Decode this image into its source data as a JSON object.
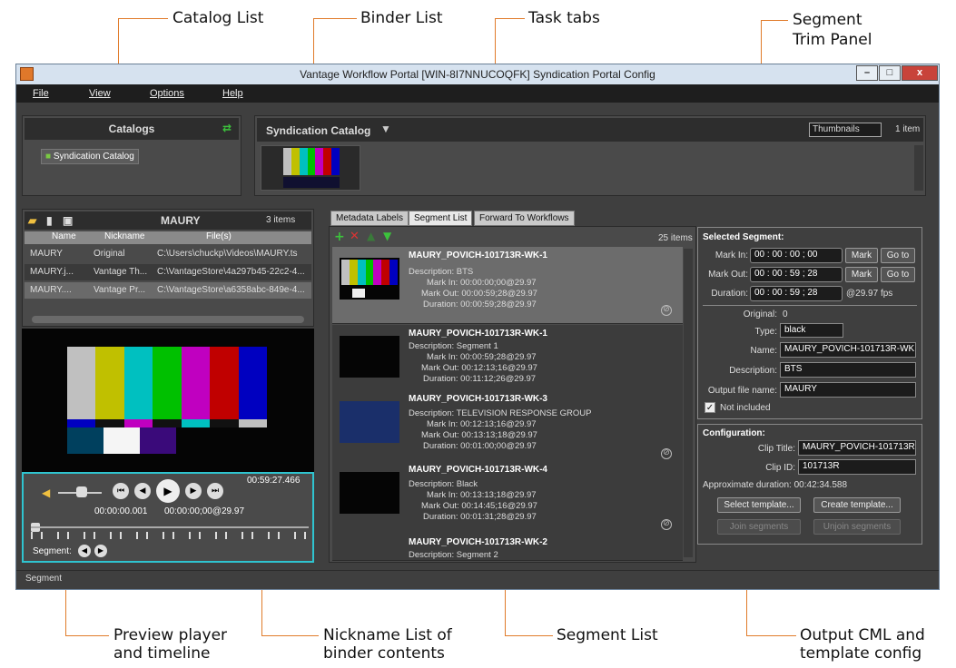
{
  "callouts": {
    "catalog": "Catalog List",
    "binder": "Binder List",
    "tasks": "Task tabs",
    "trim1": "Segment",
    "trim2": "Trim Panel",
    "preview1": "Preview player",
    "preview2": "and timeline",
    "nick1": "Nickname List of",
    "nick2": "binder contents",
    "seglist": "Segment List",
    "out1": "Output CML and",
    "out2": "template config"
  },
  "window": {
    "title": "Vantage Workflow Portal [WIN-8I7NNUCOQFK]  Syndication Portal Config",
    "min": "–",
    "max": "□",
    "close": "x"
  },
  "menu": [
    "File",
    "View",
    "Options",
    "Help"
  ],
  "catalogs": {
    "title": "Catalogs",
    "item": "Syndication Catalog"
  },
  "catalog_view": {
    "title": "Syndication Catalog",
    "view_mode": "Thumbnails",
    "count": "1 item"
  },
  "binder": {
    "title": "MAURY",
    "count": "3 items",
    "cols": [
      "Name",
      "Nickname",
      "File(s)"
    ],
    "rows": [
      [
        "MAURY",
        "Original",
        "C:\\Users\\chuckp\\Videos\\MAURY.ts"
      ],
      [
        "MAURY.j...",
        "Vantage Th...",
        "C:\\VantageStore\\4a297b45-22c2-4..."
      ],
      [
        "MAURY....",
        "Vantage Pr...",
        "C:\\VantageStore\\a6358abc-849e-4..."
      ]
    ]
  },
  "player": {
    "total": "00:59:27.466",
    "pos": "00:00:00.001",
    "tc": "00:00:00;00@29.97",
    "seg_label": "Segment:"
  },
  "tabs": [
    "Metadata Labels",
    "Segment List",
    "Forward To Workflows"
  ],
  "seglist": {
    "count": "25 items",
    "items": [
      {
        "name": "MAURY_POVICH-101713R-WK-1",
        "desc": "Description: BTS",
        "in": "Mark In: 00:00:00;00@29.97",
        "out": "Mark Out: 00:00:59;28@29.97",
        "dur": "Duration: 00:00:59;28@29.97"
      },
      {
        "name": "MAURY_POVICH-101713R-WK-1",
        "desc": "Description: Segment 1",
        "in": "Mark In: 00:00:59;28@29.97",
        "out": "Mark Out: 00:12:13;16@29.97",
        "dur": "Duration: 00:11:12;26@29.97"
      },
      {
        "name": "MAURY_POVICH-101713R-WK-3",
        "desc": "Description: TELEVISION RESPONSE GROUP",
        "in": "Mark In: 00:12:13;16@29.97",
        "out": "Mark Out: 00:13:13;18@29.97",
        "dur": "Duration: 00:01:00;00@29.97"
      },
      {
        "name": "MAURY_POVICH-101713R-WK-4",
        "desc": "Description: Black",
        "in": "Mark In: 00:13:13;18@29.97",
        "out": "Mark Out: 00:14:45;16@29.97",
        "dur": "Duration: 00:01:31;28@29.97"
      },
      {
        "name": "MAURY_POVICH-101713R-WK-2",
        "desc": "Description: Segment 2",
        "in": "",
        "out": "",
        "dur": ""
      }
    ]
  },
  "trim": {
    "title": "Selected Segment:",
    "mark_in_l": "Mark In:",
    "mark_in": "00 : 00 : 00 ; 00",
    "mark_out_l": "Mark Out:",
    "mark_out": "00 : 00 : 59 ; 28",
    "dur_l": "Duration:",
    "dur": "00 : 00 : 59 ; 28",
    "fps": "@29.97 fps",
    "mark": "Mark",
    "goto": "Go to",
    "original_l": "Original:",
    "original": "0",
    "type_l": "Type:",
    "type": "black",
    "name_l": "Name:",
    "name": "MAURY_POVICH-101713R-WK",
    "desc_l": "Description:",
    "desc": "BTS",
    "outfile_l": "Output file name:",
    "outfile": "MAURY",
    "not_included": "Not included"
  },
  "config": {
    "title": "Configuration:",
    "clip_title_l": "Clip Title:",
    "clip_title": "MAURY_POVICH-101713R",
    "clip_id_l": "Clip ID:",
    "clip_id": "101713R",
    "approx": "Approximate duration: 00:42:34.588",
    "select": "Select template...",
    "create": "Create template...",
    "join": "Join segments",
    "unjoin": "Unjoin segments"
  },
  "status": "Segment",
  "colors": {
    "accent": "#e07b2a",
    "panel": "#4a4a4a",
    "selected": "#6c6c6c",
    "player_border": "#2fc4d0"
  }
}
